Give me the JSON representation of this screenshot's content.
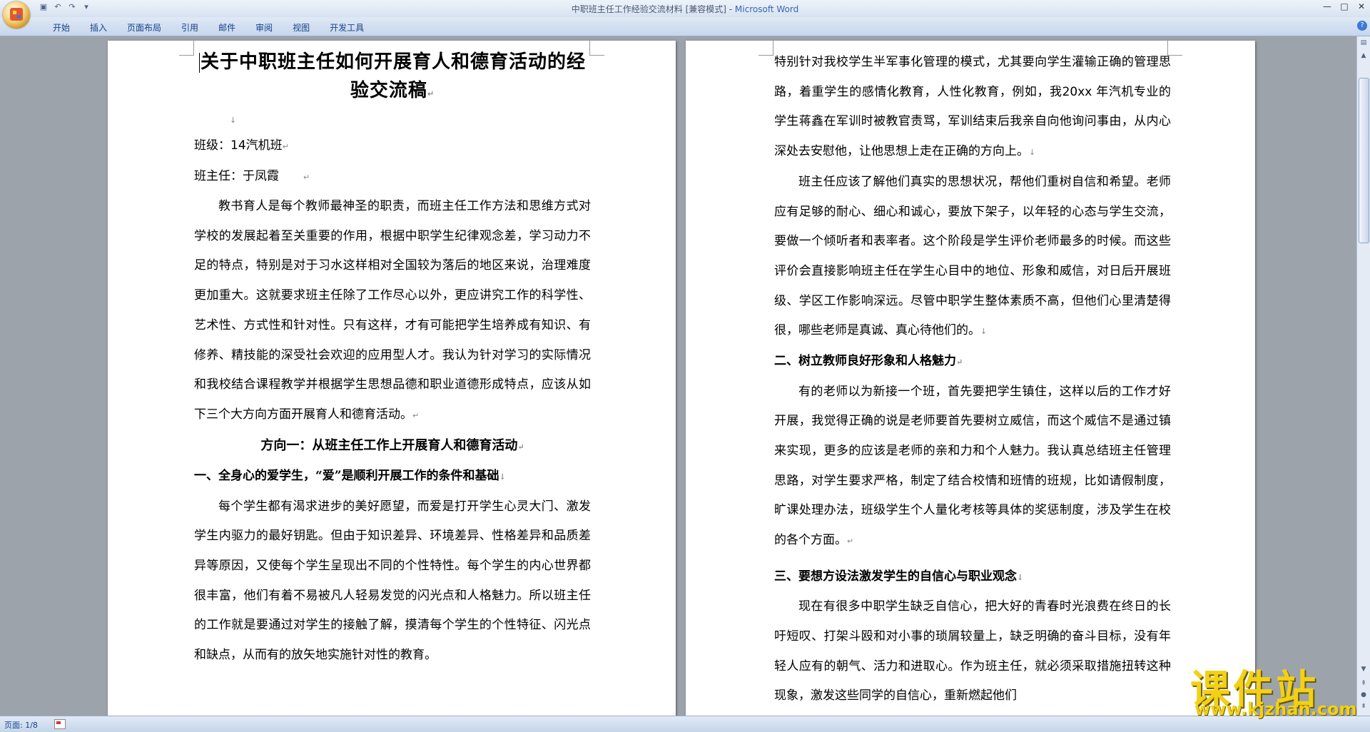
{
  "window": {
    "title": "中职班主任工作经验交流材料 [兼容模式] - ",
    "app_name": "Microsoft Word",
    "min": "—",
    "max": "□",
    "close": "✕"
  },
  "ribbon": {
    "tabs": [
      "开始",
      "插入",
      "页面布局",
      "引用",
      "邮件",
      "审阅",
      "视图",
      "开发工具"
    ],
    "help": "?"
  },
  "page1": {
    "title": "关于中职班主任如何开展育人和德育活动的经验交流稿",
    "blank_mark": "↓",
    "class_line": "班级：14汽机班",
    "teacher_line": "班主任：于凤霞",
    "para1": "教书育人是每个教师最神圣的职责，而班主任工作方法和思维方式对学校的发展起着至关重要的作用，根据中职学生纪律观念差，学习动力不足的特点，特别是对于习水这样相对全国较为落后的地区来说，治理难度更加重大。这就要求班主任除了工作尽心以外，更应讲究工作的科学性、艺术性、方式性和针对性。只有这样，才有可能把学生培养成有知识、有修养、精技能的深受社会欢迎的应用型人才。我认为针对学习的实际情况和我校结合课程教学并根据学生思想品德和职业道德形成特点，应该从如下三个大方向方面开展育人和德育活动。",
    "direction1": "方向一：从班主任工作上开展育人和德育活动",
    "heading1": "一、全身心的爱学生，“爱”是顺利开展工作的条件和基础",
    "para2": "每个学生都有渴求进步的美好愿望，而爱是打开学生心灵大门、激发学生内驱力的最好钥匙。但由于知识差异、环境差异、性格差异和品质差异等原因，又使每个学生呈现出不同的个性特性。每个学生的内心世界都很丰富，他们有着不易被凡人轻易发觉的闪光点和人格魅力。所以班主任的工作就是要通过对学生的接触了解，摸清每个学生的个性特征、闪光点和缺点，从而有的放矢地实施针对性的教育。"
  },
  "page2": {
    "para1": "特别针对我校学生半军事化管理的模式，尤其要向学生灌输正确的管理思路，着重学生的感情化教育，人性化教育，例如，我20xx 年汽机专业的学生蒋鑫在军训时被教官责骂，军训结束后我亲自向他询问事由，从内心深处去安慰他，让他思想上走在正确的方向上。",
    "para2": "班主任应该了解他们真实的思想状况，帮他们重树自信和希望。老师应有足够的耐心、细心和诚心，要放下架子，以年轻的心态与学生交流，要做一个倾听者和表率者。这个阶段是学生评价老师最多的时候。而这些评价会直接影响班主任在学生心目中的地位、形象和威信，对日后开展班级、学区工作影响深远。尽管中职学生整体素质不高，但他们心里清楚得很，哪些老师是真诚、真心待他们的。",
    "heading2": "二、树立教师良好形象和人格魅力",
    "para3": "有的老师以为新接一个班，首先要把学生镇住，这样以后的工作才好开展，我觉得正确的说是老师要首先要树立威信，而这个威信不是通过镇来实现，更多的应该是老师的亲和力和个人魅力。我认真总结班主任管理思路，对学生要求严格，制定了结合校情和班情的班规，比如请假制度，旷课处理办法，班级学生个人量化考核等具体的奖惩制度，涉及学生在校的各个方面。",
    "heading3": "三、要想方设法激发学生的自信心与职业观念",
    "para4": "现在有很多中职学生缺乏自信心，把大好的青春时光浪费在终日的长吁短叹、打架斗殴和对小事的琐屑较量上，缺乏明确的奋斗目标，没有年轻人应有的朝气、活力和进取心。作为班主任，就必须采取措施扭转这种现象，激发这些同学的自信心，重新燃起他们"
  },
  "status": {
    "page_info": "页面: 1/8"
  },
  "watermark": {
    "text": "课件站",
    "url": "www.kjzhan.com"
  }
}
